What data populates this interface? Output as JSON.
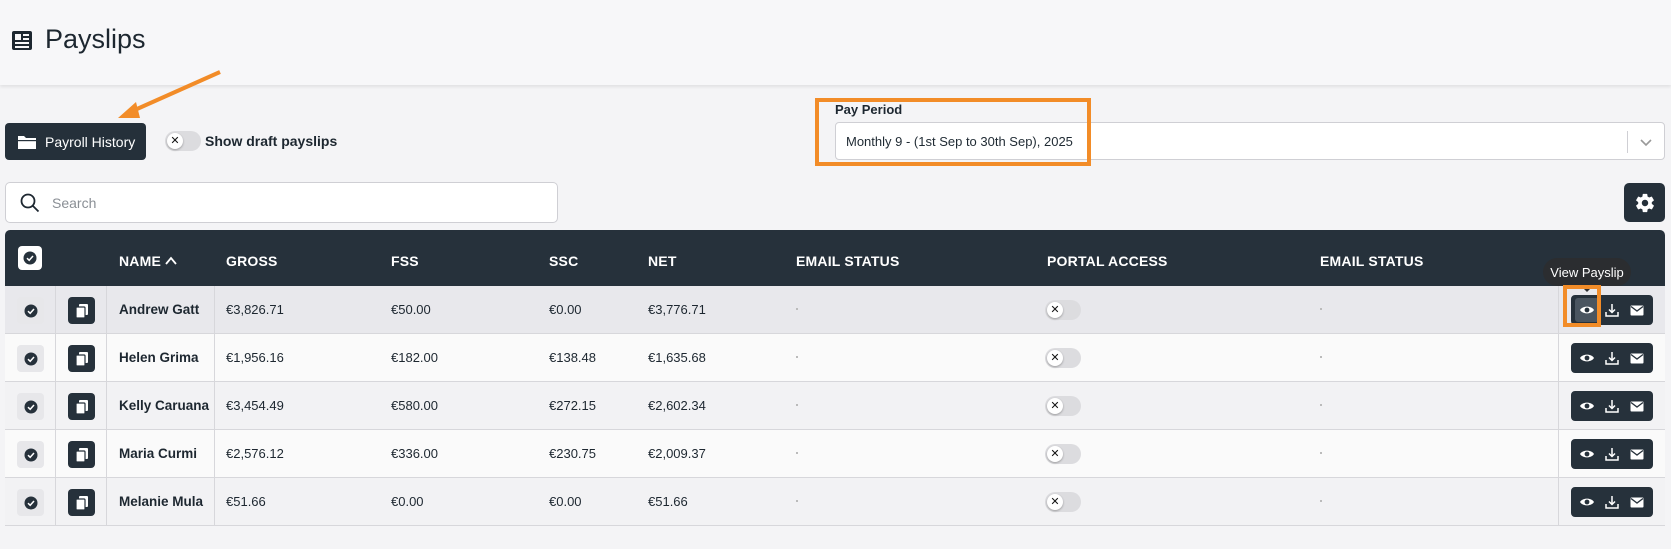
{
  "page": {
    "title": "Payslips",
    "title_icon": "newspaper-icon"
  },
  "toolbar": {
    "history_label": "Payroll History",
    "history_icon": "folder-icon",
    "draft_label": "Show draft payslips",
    "draft_enabled": false
  },
  "pay_period": {
    "label": "Pay Period",
    "value": "Monthly 9 - (1st Sep to 30th Sep), 2025"
  },
  "search": {
    "placeholder": "Search"
  },
  "table": {
    "columns": [
      "NAME",
      "GROSS",
      "FSS",
      "SSC",
      "NET",
      "EMAIL STATUS",
      "PORTAL ACCESS",
      "EMAIL STATUS"
    ],
    "sort": {
      "column": "NAME",
      "direction": "ascending"
    },
    "rows": [
      {
        "name": "Andrew Gatt",
        "gross": "€3,826.71",
        "fss": "€50.00",
        "ssc": "€0.00",
        "net": "€3,776.71",
        "portal_access": false
      },
      {
        "name": "Helen Grima",
        "gross": "€1,956.16",
        "fss": "€182.00",
        "ssc": "€138.48",
        "net": "€1,635.68",
        "portal_access": false
      },
      {
        "name": "Kelly Caruana",
        "gross": "€3,454.49",
        "fss": "€580.00",
        "ssc": "€272.15",
        "net": "€2,602.34",
        "portal_access": false
      },
      {
        "name": "Maria Curmi",
        "gross": "€2,576.12",
        "fss": "€336.00",
        "ssc": "€230.75",
        "net": "€2,009.37",
        "portal_access": false
      },
      {
        "name": "Melanie Mula",
        "gross": "€51.66",
        "fss": "€0.00",
        "ssc": "€0.00",
        "net": "€51.66",
        "portal_access": false
      }
    ]
  },
  "tooltip": {
    "text": "View Payslip"
  },
  "colors": {
    "dark": "#26313b",
    "highlight": "#f28c28",
    "background": "#f4f4f6"
  }
}
